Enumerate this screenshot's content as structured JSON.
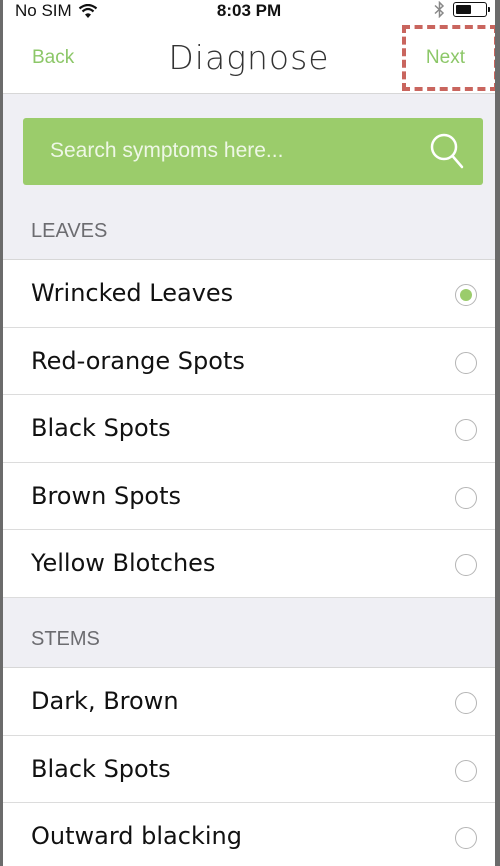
{
  "status_bar": {
    "carrier": "No SIM",
    "time": "8:03 PM",
    "icons": [
      "wifi-icon",
      "bluetooth-icon",
      "battery-icon"
    ]
  },
  "nav": {
    "back_label": "Back",
    "title": "Diagnose",
    "next_label": "Next"
  },
  "search": {
    "placeholder": "Search symptoms here...",
    "icon": "search-icon"
  },
  "sections": [
    {
      "header": "LEAVES",
      "items": [
        {
          "label": "Wrincked Leaves",
          "selected": true
        },
        {
          "label": "Red-orange Spots",
          "selected": false
        },
        {
          "label": "Black Spots",
          "selected": false
        },
        {
          "label": "Brown Spots",
          "selected": false
        },
        {
          "label": "Yellow Blotches",
          "selected": false
        }
      ]
    },
    {
      "header": "STEMS",
      "items": [
        {
          "label": "Dark, Brown",
          "selected": false
        },
        {
          "label": "Black Spots",
          "selected": false
        },
        {
          "label": "Outward blacking",
          "selected": false
        }
      ]
    }
  ],
  "colors": {
    "accent": "#9bcc6b",
    "highlight": "#c9655e"
  }
}
